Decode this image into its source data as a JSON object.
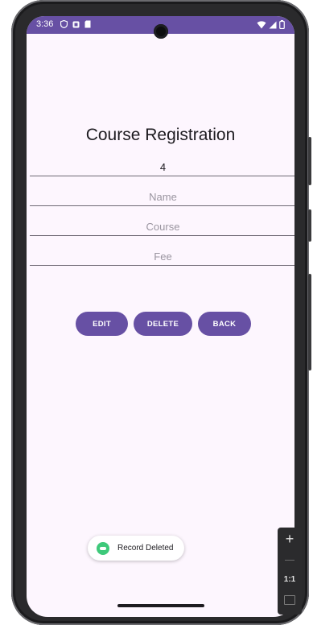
{
  "status_bar": {
    "time": "3:36",
    "background": "#6750a4",
    "left_icons": [
      "shield-icon",
      "notification-icon",
      "sd-card-icon"
    ],
    "right_icons": [
      "wifi-icon",
      "signal-icon",
      "battery-icon"
    ]
  },
  "form": {
    "title": "Course Registration",
    "id_value": "4",
    "name_placeholder": "Name",
    "course_placeholder": "Course",
    "fee_placeholder": "Fee"
  },
  "buttons": {
    "edit_label": "EDIT",
    "delete_label": "DELETE",
    "back_label": "BACK",
    "color": "#6750a4"
  },
  "toast": {
    "message": "Record Deleted",
    "icon": "app-icon"
  },
  "emulator_zoom": {
    "ratio_label": "1:1",
    "zoom_in_symbol": "+"
  }
}
